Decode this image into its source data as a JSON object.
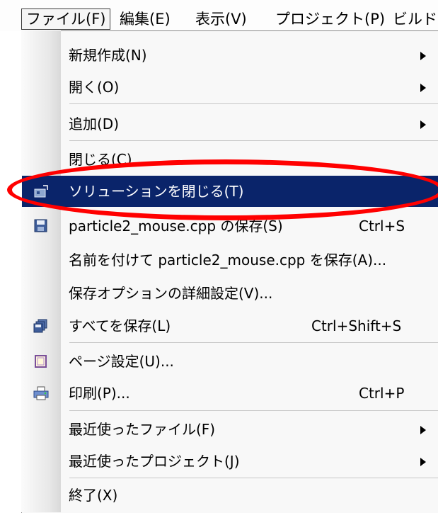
{
  "menubar": {
    "items": [
      {
        "label": "ファイル(F)"
      },
      {
        "label": "編集(E)"
      },
      {
        "label": "表示(V)"
      },
      {
        "label": "プロジェクト(P)"
      },
      {
        "label": "ビルド("
      }
    ]
  },
  "file_menu": {
    "items": [
      {
        "label": "新規作成(N)",
        "submenu": true
      },
      {
        "label": "開く(O)",
        "submenu": true
      },
      {
        "label": "追加(D)",
        "submenu": true
      },
      {
        "label": "閉じる(C)"
      },
      {
        "label": "ソリューションを閉じる(T)",
        "highlighted": true,
        "icon": "close-solution-icon"
      },
      {
        "label": "particle2_mouse.cpp の保存(S)",
        "shortcut": "Ctrl+S",
        "icon": "save-icon"
      },
      {
        "label": "名前を付けて particle2_mouse.cpp を保存(A)..."
      },
      {
        "label": "保存オプションの詳細設定(V)..."
      },
      {
        "label": "すべてを保存(L)",
        "shortcut": "Ctrl+Shift+S",
        "icon": "save-all-icon"
      },
      {
        "label": "ページ設定(U)...",
        "icon": "page-setup-icon"
      },
      {
        "label": "印刷(P)...",
        "shortcut": "Ctrl+P",
        "icon": "print-icon"
      },
      {
        "label": "最近使ったファイル(F)",
        "submenu": true
      },
      {
        "label": "最近使ったプロジェクト(J)",
        "submenu": true
      },
      {
        "label": "終了(X)"
      }
    ]
  },
  "colors": {
    "highlight": "#0a246a",
    "annotation": "#ff0000"
  }
}
